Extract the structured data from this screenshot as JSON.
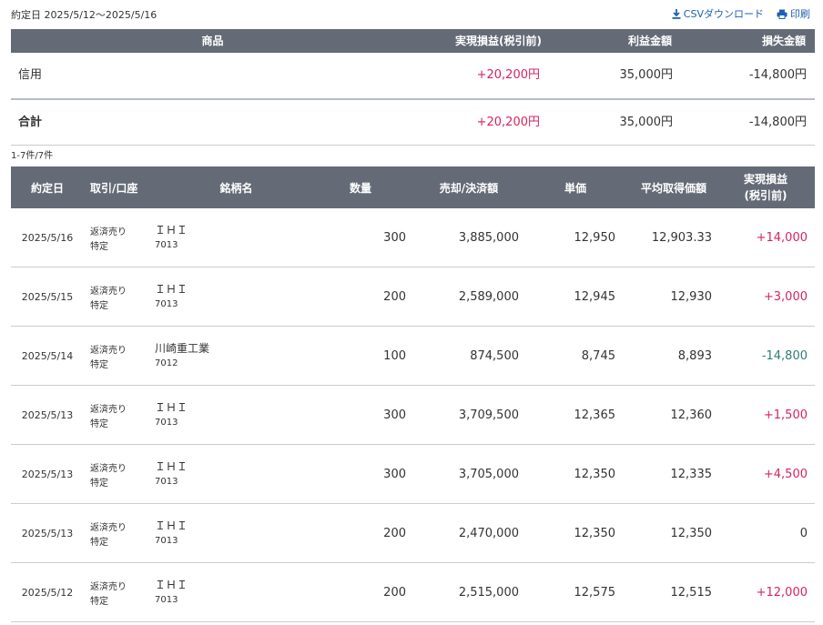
{
  "period": "約定日 2025/5/12〜2025/5/16",
  "actions": {
    "csv": "CSVダウンロード",
    "print": "印刷"
  },
  "summary": {
    "headers": {
      "product": "商品",
      "realized": "実現損益(税引前)",
      "profit": "利益金額",
      "loss": "損失金額"
    },
    "rows": [
      {
        "label": "信用",
        "realized": "+20,200円",
        "profit": "35,000円",
        "loss": "-14,800円"
      },
      {
        "label": "合計",
        "realized": "+20,200円",
        "profit": "35,000円",
        "loss": "-14,800円"
      }
    ]
  },
  "count": "1-7件/7件",
  "detail": {
    "headers": {
      "date": "約定日",
      "account": "取引/口座",
      "name": "銘柄名",
      "qty": "数量",
      "amount": "売却/決済額",
      "price": "単価",
      "avg": "平均取得価額",
      "pl": "実現損益\n(税引前)"
    },
    "rows": [
      {
        "date": "2025/5/16",
        "trade": "返済売り",
        "account": "特定",
        "name": "ＩＨＩ",
        "code": "7013",
        "qty": "300",
        "amount": "3,885,000",
        "price": "12,950",
        "avg": "12,903.33",
        "pl": "+14,000",
        "pl_sign": "pos"
      },
      {
        "date": "2025/5/15",
        "trade": "返済売り",
        "account": "特定",
        "name": "ＩＨＩ",
        "code": "7013",
        "qty": "200",
        "amount": "2,589,000",
        "price": "12,945",
        "avg": "12,930",
        "pl": "+3,000",
        "pl_sign": "pos"
      },
      {
        "date": "2025/5/14",
        "trade": "返済売り",
        "account": "特定",
        "name": "川崎重工業",
        "code": "7012",
        "qty": "100",
        "amount": "874,500",
        "price": "8,745",
        "avg": "8,893",
        "pl": "-14,800",
        "pl_sign": "neg"
      },
      {
        "date": "2025/5/13",
        "trade": "返済売り",
        "account": "特定",
        "name": "ＩＨＩ",
        "code": "7013",
        "qty": "300",
        "amount": "3,709,500",
        "price": "12,365",
        "avg": "12,360",
        "pl": "+1,500",
        "pl_sign": "pos"
      },
      {
        "date": "2025/5/13",
        "trade": "返済売り",
        "account": "特定",
        "name": "ＩＨＩ",
        "code": "7013",
        "qty": "300",
        "amount": "3,705,000",
        "price": "12,350",
        "avg": "12,335",
        "pl": "+4,500",
        "pl_sign": "pos"
      },
      {
        "date": "2025/5/13",
        "trade": "返済売り",
        "account": "特定",
        "name": "ＩＨＩ",
        "code": "7013",
        "qty": "200",
        "amount": "2,470,000",
        "price": "12,350",
        "avg": "12,350",
        "pl": "0",
        "pl_sign": "zero"
      },
      {
        "date": "2025/5/12",
        "trade": "返済売り",
        "account": "特定",
        "name": "ＩＨＩ",
        "code": "7013",
        "qty": "200",
        "amount": "2,515,000",
        "price": "12,575",
        "avg": "12,515",
        "pl": "+12,000",
        "pl_sign": "pos"
      }
    ]
  },
  "colors": {
    "header_bg": "#646b76",
    "link": "#1e5fb6",
    "positive": "#d6245c",
    "negative": "#2f7d75"
  },
  "icons": {
    "csv": "download-icon",
    "print": "printer-icon"
  }
}
